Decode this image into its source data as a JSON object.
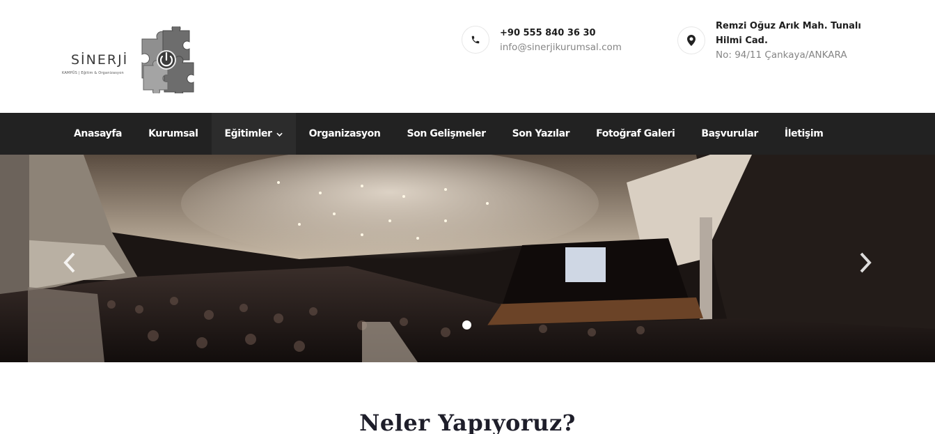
{
  "brand": {
    "name": "SİNERJİ",
    "tagline": "KAMPÜS | Eğitim & Organizasyon"
  },
  "contact": {
    "phone": "+90 555 840 36 30",
    "email": "info@sinerjikurumsal.com",
    "address_line1": "Remzi Oğuz Arık Mah. Tunalı Hilmi Cad.",
    "address_line2": "No: 94/11 Çankaya/ANKARA"
  },
  "nav": {
    "items": [
      {
        "label": "Anasayfa"
      },
      {
        "label": "Kurumsal"
      },
      {
        "label": "Eğitimler"
      },
      {
        "label": "Organizasyon"
      },
      {
        "label": "Son Gelişmeler"
      },
      {
        "label": "Son Yazılar"
      },
      {
        "label": "Fotoğraf Galeri"
      },
      {
        "label": "Başvurular"
      },
      {
        "label": "İletişim"
      }
    ]
  },
  "icons": {
    "phone": "phone-icon",
    "location": "map-marker-icon",
    "dropdown": "chevron-down-icon",
    "prev": "chevron-left-icon",
    "next": "chevron-right-icon"
  },
  "colors": {
    "nav_bg": "#222222",
    "text_dark": "#1d1d1d",
    "text_light": "#858585"
  },
  "section": {
    "title": "Neler Yapıyoruz?"
  }
}
